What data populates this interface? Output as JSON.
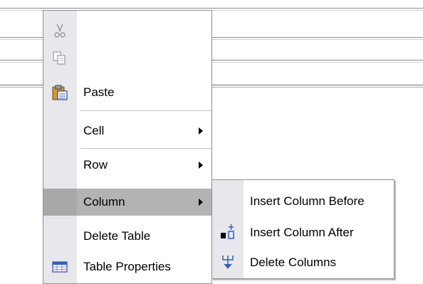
{
  "menu": {
    "items": [
      {
        "label": "",
        "icon": "cut-icon",
        "disabled": true
      },
      {
        "label": "",
        "icon": "copy-icon",
        "disabled": true
      },
      {
        "label": "Paste",
        "icon": "paste-icon"
      },
      {
        "label": "Cell",
        "submenu": true
      },
      {
        "label": "Row",
        "submenu": true
      },
      {
        "label": "Column",
        "submenu": true,
        "highlighted": true
      },
      {
        "label": "Delete Table"
      },
      {
        "label": "Table Properties",
        "icon": "table-properties-icon"
      }
    ]
  },
  "submenu": {
    "items": [
      {
        "label": "Insert Column Before"
      },
      {
        "label": "Insert Column After",
        "icon": "insert-column-after-icon"
      },
      {
        "label": "Delete Columns",
        "icon": "delete-columns-icon"
      }
    ]
  },
  "colors": {
    "highlight": "#b3b3b3",
    "gutter": "#e7e7ec",
    "icon_blue": "#3a5fb0"
  }
}
